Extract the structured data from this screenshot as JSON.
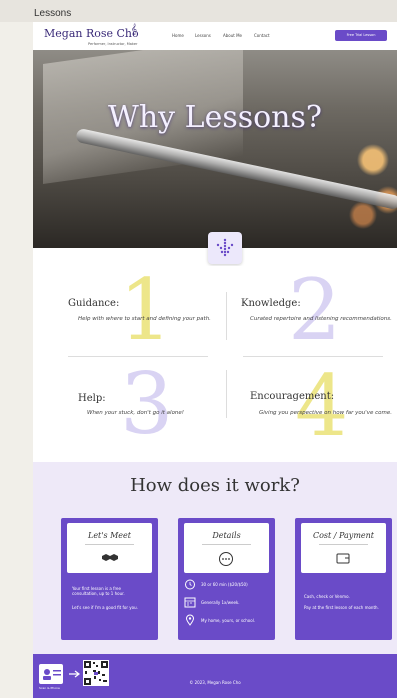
{
  "window": {
    "title": "Lessons"
  },
  "header": {
    "brand": "Megan Rose Cho",
    "tagline": "Performer, Instructor, Maker",
    "nav": [
      "Home",
      "Lessons",
      "About Me",
      "Contact"
    ],
    "cta": "Free Trial Lesson"
  },
  "hero": {
    "title": "Why Lessons?"
  },
  "why": {
    "items": [
      {
        "num": "1",
        "title": "Guidance:",
        "desc": "Help with where to start and defining your path."
      },
      {
        "num": "2",
        "title": "Knowledge:",
        "desc": "Curated repertoire and listening recommendations."
      },
      {
        "num": "3",
        "title": "Help:",
        "desc": "When your stuck, don't go it alone!"
      },
      {
        "num": "4",
        "title": "Encouragement:",
        "desc": "Giving you perspective on how far you've come."
      }
    ]
  },
  "how": {
    "title": "How does it work?",
    "meet": {
      "title": "Let's Meet",
      "line1": "Your first lesson is a free consultation, up to 1 hour.",
      "line2": "Let's see if I'm a good fit for you."
    },
    "details": {
      "title": "Details",
      "rows": [
        "30 or 60 min ($20/$50)",
        "Generally 1x/week.",
        "My home, yours, or school."
      ]
    },
    "payment": {
      "title": "Cost / Payment",
      "line1": "Cash, check or Venmo.",
      "line2": "Pay at the first lesson of each month."
    }
  },
  "footer": {
    "card_label": "Scan & Phone",
    "copyright": "© 2023, Megan Rose Cho"
  },
  "colors": {
    "accent": "#6a4bc8",
    "num_yellow": "#ede68a",
    "num_lavender": "#d9d3f3",
    "how_bg": "#eee9f8"
  }
}
